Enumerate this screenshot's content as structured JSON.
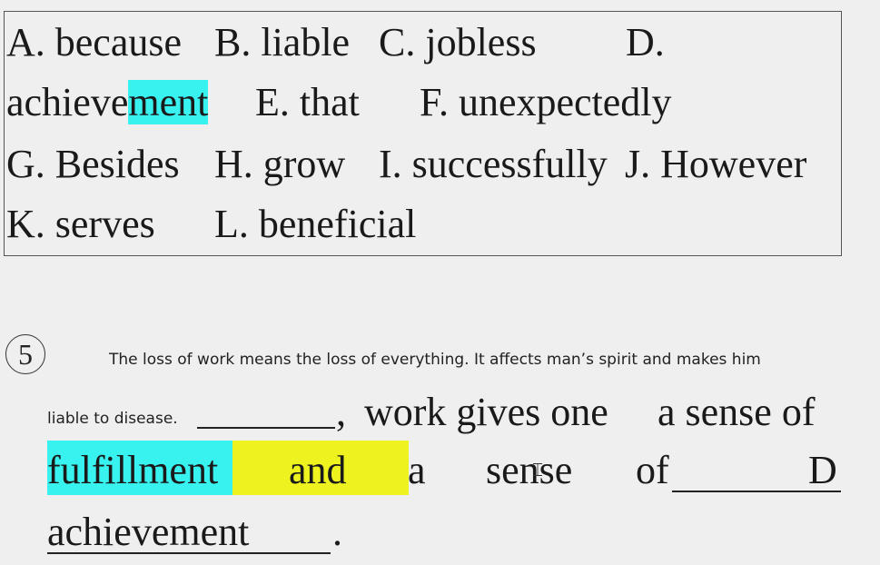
{
  "options": [
    {
      "id": "A",
      "text": "A.  because"
    },
    {
      "id": "B",
      "text": "B. liable"
    },
    {
      "id": "C",
      "text": "C. jobless"
    },
    {
      "id": "D_label",
      "text": "D."
    },
    {
      "id": "D_word_a",
      "text": "achieve"
    },
    {
      "id": "D_word_b",
      "text": "ment"
    },
    {
      "id": "E",
      "text": "E. that"
    },
    {
      "id": "F",
      "text": "F. unexpectedly"
    },
    {
      "id": "G",
      "text": "G. Besides"
    },
    {
      "id": "H",
      "text": "H. grow"
    },
    {
      "id": "I",
      "text": "I. successfully"
    },
    {
      "id": "J",
      "text": "J. However"
    },
    {
      "id": "K",
      "text": "K. serves"
    },
    {
      "id": "L",
      "text": "L. beneficial"
    }
  ],
  "question": {
    "number": "5",
    "line1": "The loss of work means the loss of everything. It affects man’s spirit and makes him",
    "line2_small": "liable to disease.",
    "line2_comma": ",",
    "line2_black": "work gives one",
    "line2_red": "a sense of",
    "line3_fulfillment": "fulfillment",
    "line3_and": "and",
    "line3_a": "a",
    "line3_sense": "sense",
    "line3_of": "of",
    "line3_answer": "D",
    "line4_word": "achievement",
    "line4_period": "."
  },
  "colors": {
    "highlight_cyan": "#38f2f0",
    "highlight_yellow": "#eef21f",
    "red_text": "#c8102e"
  }
}
